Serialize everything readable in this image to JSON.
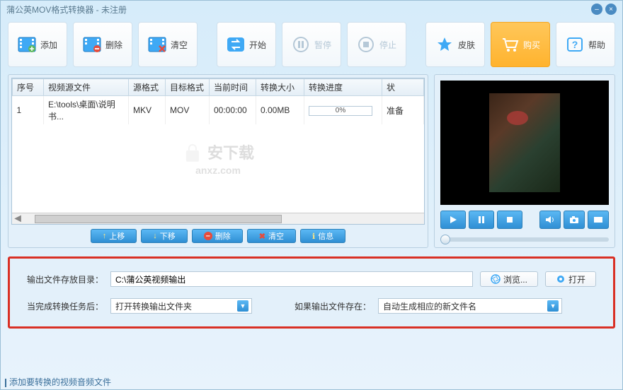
{
  "window": {
    "title": "蒲公英MOV格式转换器 - 未注册"
  },
  "toolbar": {
    "add": "添加",
    "delete": "删除",
    "clear": "清空",
    "start": "开始",
    "pause": "暂停",
    "stop": "停止",
    "skin": "皮肤",
    "buy": "购买",
    "help": "帮助"
  },
  "table": {
    "headers": {
      "seq": "序号",
      "source": "视频源文件",
      "src_fmt": "源格式",
      "dst_fmt": "目标格式",
      "time": "当前时间",
      "size": "转换大小",
      "progress": "转换进度",
      "status": "状"
    },
    "rows": [
      {
        "seq": "1",
        "source": "E:\\tools\\桌面\\说明书...",
        "src_fmt": "MKV",
        "dst_fmt": "MOV",
        "time": "00:00:00",
        "size": "0.00MB",
        "progress": "0%",
        "status": "准备"
      }
    ]
  },
  "watermark": {
    "title": "安下载",
    "sub": "anxz.com"
  },
  "list_actions": {
    "up": "上移",
    "down": "下移",
    "delete": "删除",
    "clear": "清空",
    "info": "信息"
  },
  "output": {
    "dir_label": "输出文件存放目录：",
    "dir_value": "C:\\蒲公英视频输出",
    "browse": "浏览...",
    "open": "打开",
    "after_label": "当完成转换任务后：",
    "after_value": "打开转换输出文件夹",
    "exists_label": "如果输出文件存在：",
    "exists_value": "自动生成相应的新文件名"
  },
  "status_bar": "添加要转换的视频音频文件"
}
